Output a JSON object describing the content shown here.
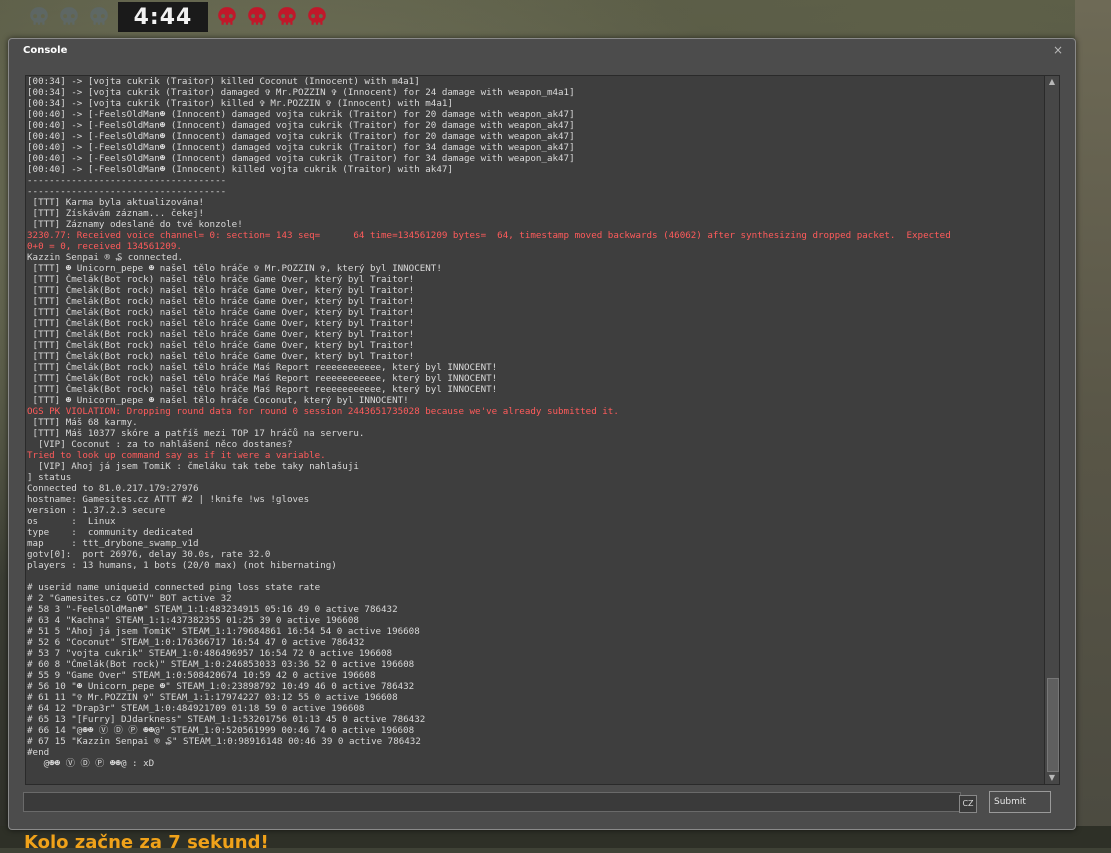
{
  "hud": {
    "timer": "4:44",
    "icons": [
      "skull-icon-dead",
      "skull-icon-dead",
      "skull-icon-dead",
      "skull-icon-alive",
      "skull-icon-alive",
      "skull-icon-alive",
      "skull-icon-alive"
    ],
    "colors": {
      "dead": "#5b6b78",
      "alive": "#c0182a"
    }
  },
  "round_message": "Kolo začne za 7 sekund!",
  "console": {
    "title": "Console",
    "close_glyph": "×",
    "lang": "CZ",
    "submit_label": "Submit",
    "input_value": "",
    "lines": [
      {
        "text": "[00:34] -> [vojta cukrik (Traitor) killed Coconut (Innocent) with m4a1]",
        "type": "normal"
      },
      {
        "text": "[00:34] -> [vojta cukrik (Traitor) damaged ✞ Mr.POZZIN ✞ (Innocent) for 24 damage with weapon_m4a1]",
        "type": "normal"
      },
      {
        "text": "[00:34] -> [vojta cukrik (Traitor) killed ✞ Mr.POZZIN ✞ (Innocent) with m4a1]",
        "type": "normal"
      },
      {
        "text": "[00:40] -> [-FeelsOldMan☻ (Innocent) damaged vojta cukrik (Traitor) for 20 damage with weapon_ak47]",
        "type": "normal"
      },
      {
        "text": "[00:40] -> [-FeelsOldMan☻ (Innocent) damaged vojta cukrik (Traitor) for 20 damage with weapon_ak47]",
        "type": "normal"
      },
      {
        "text": "[00:40] -> [-FeelsOldMan☻ (Innocent) damaged vojta cukrik (Traitor) for 20 damage with weapon_ak47]",
        "type": "normal"
      },
      {
        "text": "[00:40] -> [-FeelsOldMan☻ (Innocent) damaged vojta cukrik (Traitor) for 34 damage with weapon_ak47]",
        "type": "normal"
      },
      {
        "text": "[00:40] -> [-FeelsOldMan☻ (Innocent) damaged vojta cukrik (Traitor) for 34 damage with weapon_ak47]",
        "type": "normal"
      },
      {
        "text": "[00:40] -> [-FeelsOldMan☻ (Innocent) killed vojta cukrik (Traitor) with ak47]",
        "type": "normal"
      },
      {
        "text": "------------------------------------",
        "type": "normal"
      },
      {
        "text": "------------------------------------",
        "type": "normal"
      },
      {
        "text": " [TTT] Karma byla aktualizována!",
        "type": "normal"
      },
      {
        "text": " [TTT] Získávám záznam... čekej!",
        "type": "normal"
      },
      {
        "text": " [TTT] Záznamy odeslané do tvé konzole!",
        "type": "normal"
      },
      {
        "text": "3230.77: Received voice channel= 0: section= 143 seq=      64 time=134561209 bytes=  64, timestamp moved backwards (46062) after synthesizing dropped packet.  Expected",
        "type": "error"
      },
      {
        "text": "0+0 = 0, received 134561209.",
        "type": "error"
      },
      {
        "text": "Kazzin Senpai ® ₷ connected.",
        "type": "normal"
      },
      {
        "text": " [TTT] ☻ Unicorn_pepe ☻ našel tělo hráče ✞ Mr.POZZIN ✞, který byl INNOCENT!",
        "type": "normal"
      },
      {
        "text": " [TTT] Čmelák(Bot rock) našel tělo hráče Game Over, který byl Traitor!",
        "type": "normal"
      },
      {
        "text": " [TTT] Čmelák(Bot rock) našel tělo hráče Game Over, který byl Traitor!",
        "type": "normal"
      },
      {
        "text": " [TTT] Čmelák(Bot rock) našel tělo hráče Game Over, který byl Traitor!",
        "type": "normal"
      },
      {
        "text": " [TTT] Čmelák(Bot rock) našel tělo hráče Game Over, který byl Traitor!",
        "type": "normal"
      },
      {
        "text": " [TTT] Čmelák(Bot rock) našel tělo hráče Game Over, který byl Traitor!",
        "type": "normal"
      },
      {
        "text": " [TTT] Čmelák(Bot rock) našel tělo hráče Game Over, který byl Traitor!",
        "type": "normal"
      },
      {
        "text": " [TTT] Čmelák(Bot rock) našel tělo hráče Game Over, který byl Traitor!",
        "type": "normal"
      },
      {
        "text": " [TTT] Čmelák(Bot rock) našel tělo hráče Game Over, který byl Traitor!",
        "type": "normal"
      },
      {
        "text": " [TTT] Čmelák(Bot rock) našel tělo hráče Maś Report reeeeeeeeeee, který byl INNOCENT!",
        "type": "normal"
      },
      {
        "text": " [TTT] Čmelák(Bot rock) našel tělo hráče Maś Report reeeeeeeeeee, který byl INNOCENT!",
        "type": "normal"
      },
      {
        "text": " [TTT] Čmelák(Bot rock) našel tělo hráče Maś Report reeeeeeeeeee, který byl INNOCENT!",
        "type": "normal"
      },
      {
        "text": " [TTT] ☻ Unicorn_pepe ☻ našel tělo hráče Coconut, který byl INNOCENT!",
        "type": "normal"
      },
      {
        "text": "OGS PK VIOLATION: Dropping round data for round 0 session 2443651735028 because we've already submitted it.",
        "type": "error"
      },
      {
        "text": " [TTT] Máš 68 karmy.",
        "type": "normal"
      },
      {
        "text": " [TTT] Máš 10377 skóre a patříš mezi TOP 17 hráčů na serveru.",
        "type": "normal"
      },
      {
        "text": "  [VIP] Coconut : za to nahlášení něco dostanes?",
        "type": "normal"
      },
      {
        "text": "Tried to look up command say as if it were a variable.",
        "type": "error"
      },
      {
        "text": "  [VIP] Ahoj já jsem TomiK : čmeláku tak tebe taky nahlašuji",
        "type": "normal"
      },
      {
        "text": "] status",
        "type": "normal"
      },
      {
        "text": "Connected to 81.0.217.179:27976",
        "type": "normal"
      },
      {
        "text": "hostname: Gamesites.cz ATTT #2 | !knife !ws !gloves",
        "type": "normal"
      },
      {
        "text": "version : 1.37.2.3 secure",
        "type": "normal"
      },
      {
        "text": "os      :  Linux",
        "type": "normal"
      },
      {
        "text": "type    :  community dedicated",
        "type": "normal"
      },
      {
        "text": "map     : ttt_drybone_swamp_v1d",
        "type": "normal"
      },
      {
        "text": "gotv[0]:  port 26976, delay 30.0s, rate 32.0",
        "type": "normal"
      },
      {
        "text": "players : 13 humans, 1 bots (20/0 max) (not hibernating)",
        "type": "normal"
      },
      {
        "text": "",
        "type": "normal"
      },
      {
        "text": "# userid name uniqueid connected ping loss state rate",
        "type": "normal"
      },
      {
        "text": "# 2 \"Gamesites.cz GOTV\" BOT active 32",
        "type": "normal"
      },
      {
        "text": "# 58 3 \"-FeelsOldMan☻\" STEAM_1:1:483234915 05:16 49 0 active 786432",
        "type": "normal"
      },
      {
        "text": "# 63 4 \"Kachna\" STEAM_1:1:437382355 01:25 39 0 active 196608",
        "type": "normal"
      },
      {
        "text": "# 51 5 \"Ahoj já jsem TomiK\" STEAM_1:1:79684861 16:54 54 0 active 196608",
        "type": "normal"
      },
      {
        "text": "# 52 6 \"Coconut\" STEAM_1:0:176366717 16:54 47 0 active 786432",
        "type": "normal"
      },
      {
        "text": "# 53 7 \"vojta cukrik\" STEAM_1:0:486496957 16:54 72 0 active 196608",
        "type": "normal"
      },
      {
        "text": "# 60 8 \"Čmelák(Bot rock)\" STEAM_1:0:246853033 03:36 52 0 active 196608",
        "type": "normal"
      },
      {
        "text": "# 55 9 \"Game Over\" STEAM_1:0:508420674 10:59 42 0 active 196608",
        "type": "normal"
      },
      {
        "text": "# 56 10 \"☻ Unicorn_pepe ☻\" STEAM_1:0:23898792 10:49 46 0 active 786432",
        "type": "normal"
      },
      {
        "text": "# 61 11 \"✞ Mr.POZZIN ✞\" STEAM_1:1:17974227 03:12 55 0 active 196608",
        "type": "normal"
      },
      {
        "text": "# 64 12 \"Drap3r\" STEAM_1:0:484921709 01:18 59 0 active 196608",
        "type": "normal"
      },
      {
        "text": "# 65 13 \"[Furry] DJdarkness\" STEAM_1:1:53201756 01:13 45 0 active 786432",
        "type": "normal"
      },
      {
        "text": "# 66 14 \"@☻☻ Ⓥ Ⓓ Ⓟ ☻☻@\" STEAM_1:0:520561999 00:46 74 0 active 196608",
        "type": "normal"
      },
      {
        "text": "# 67 15 \"Kazzin Senpai ® ₷\" STEAM_1:0:98916148 00:46 39 0 active 786432",
        "type": "normal"
      },
      {
        "text": "#end",
        "type": "normal"
      },
      {
        "text": "   @☻☻ Ⓥ Ⓓ Ⓟ ☻☻@ : xD",
        "type": "normal"
      }
    ]
  }
}
